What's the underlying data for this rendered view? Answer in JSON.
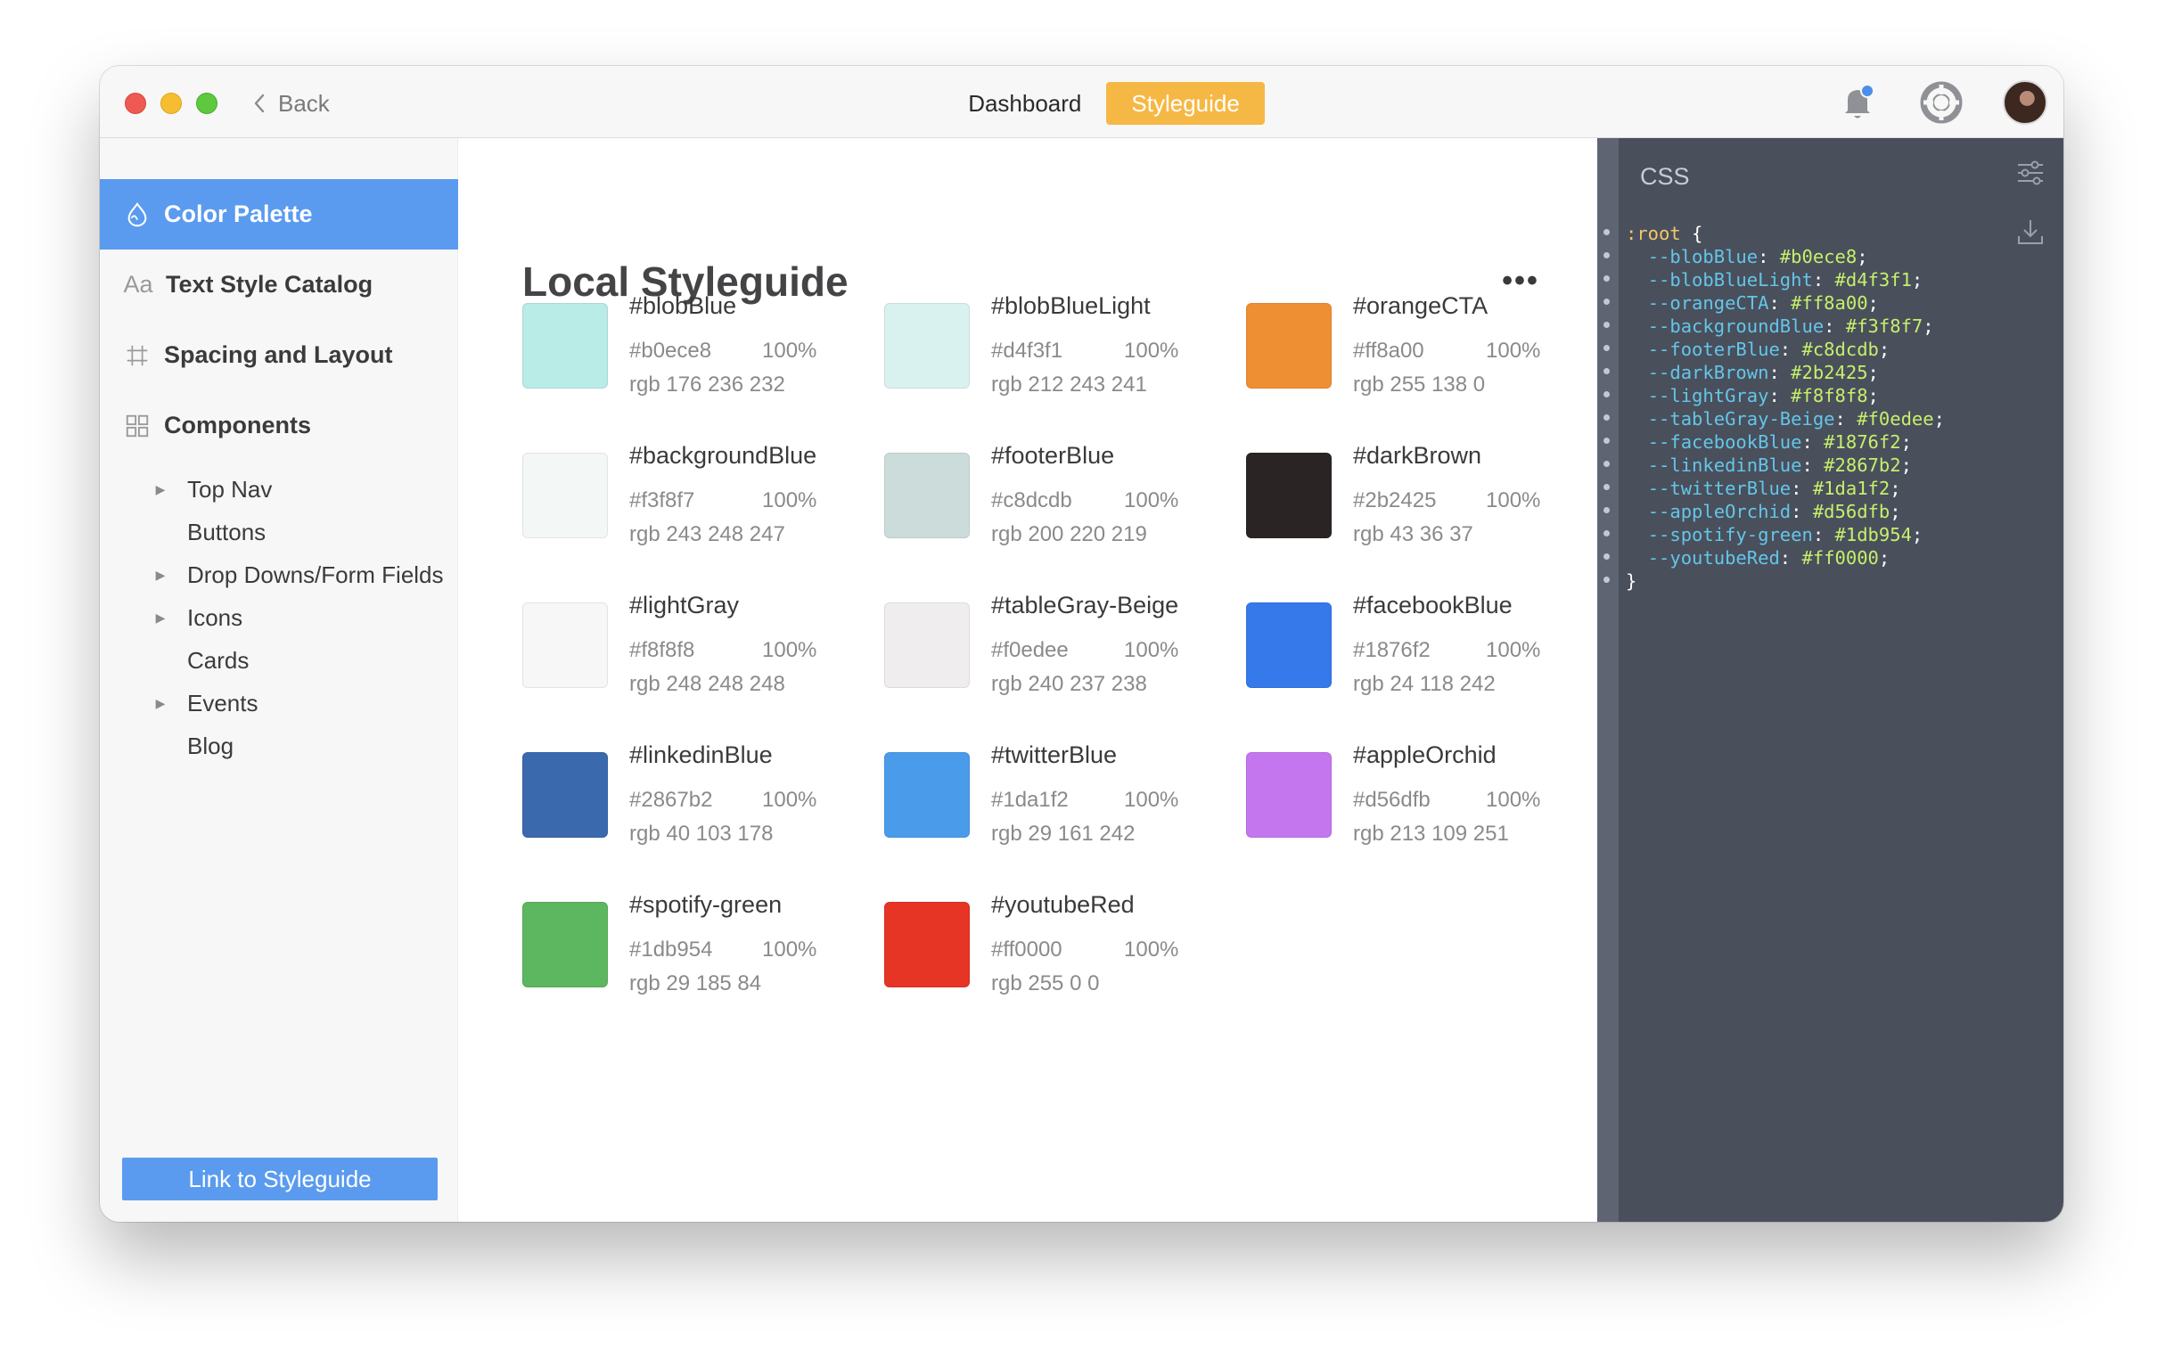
{
  "titlebar": {
    "back_label": "Back",
    "tabs": [
      {
        "label": "Dashboard",
        "active": false
      },
      {
        "label": "Styleguide",
        "active": true
      }
    ],
    "accent_color": "#f6b845"
  },
  "sidebar": {
    "items": [
      {
        "label": "Color Palette",
        "icon": "color-drop-icon",
        "active": true
      },
      {
        "label": "Text Style Catalog",
        "icon": "text-aa-icon",
        "active": false
      },
      {
        "label": "Spacing and Layout",
        "icon": "grid-hash-icon",
        "active": false
      },
      {
        "label": "Components",
        "icon": "components-grid-icon",
        "active": false
      }
    ],
    "components_children": [
      {
        "label": "Top Nav",
        "expandable": true
      },
      {
        "label": "Buttons",
        "expandable": false
      },
      {
        "label": "Drop Downs/Form Fields",
        "expandable": true
      },
      {
        "label": "Icons",
        "expandable": true
      },
      {
        "label": "Cards",
        "expandable": false
      },
      {
        "label": "Events",
        "expandable": true
      },
      {
        "label": "Blog",
        "expandable": false
      }
    ],
    "link_button": "Link to Styleguide",
    "active_color": "#5a9bef"
  },
  "main": {
    "title": "Local Styleguide",
    "more_label": "•••",
    "colors": [
      {
        "name": "#blobBlue",
        "hex": "#b0ece8",
        "opacity": "100%",
        "rgb": "rgb 176 236 232"
      },
      {
        "name": "#blobBlueLight",
        "hex": "#d4f3f1",
        "opacity": "100%",
        "rgb": "rgb 212 243 241"
      },
      {
        "name": "#orangeCTA",
        "hex": "#ff8a00",
        "opacity": "100%",
        "rgb": "rgb 255 138 0"
      },
      {
        "name": "#backgroundBlue",
        "hex": "#f3f8f7",
        "opacity": "100%",
        "rgb": "rgb 243 248 247"
      },
      {
        "name": "#footerBlue",
        "hex": "#c8dcdb",
        "opacity": "100%",
        "rgb": "rgb 200 220 219"
      },
      {
        "name": "#darkBrown",
        "hex": "#2b2425",
        "opacity": "100%",
        "rgb": "rgb 43 36 37"
      },
      {
        "name": "#lightGray",
        "hex": "#f8f8f8",
        "opacity": "100%",
        "rgb": "rgb 248 248 248"
      },
      {
        "name": "#tableGray-Beige",
        "hex": "#f0edee",
        "opacity": "100%",
        "rgb": "rgb 240 237 238"
      },
      {
        "name": "#facebookBlue",
        "hex": "#1876f2",
        "opacity": "100%",
        "rgb": "rgb 24 118 242"
      },
      {
        "name": "#linkedinBlue",
        "hex": "#2867b2",
        "opacity": "100%",
        "rgb": "rgb 40 103 178"
      },
      {
        "name": "#twitterBlue",
        "hex": "#1da1f2",
        "opacity": "100%",
        "rgb": "rgb 29 161 242"
      },
      {
        "name": "#appleOrchid",
        "hex": "#d56dfb",
        "opacity": "100%",
        "rgb": "rgb 213 109 251"
      },
      {
        "name": "#spotify-green",
        "hex": "#1db954",
        "opacity": "100%",
        "rgb": "rgb 29 185 84"
      },
      {
        "name": "#youtubeRed",
        "hex": "#ff0000",
        "opacity": "100%",
        "rgb": "rgb 255 0 0"
      }
    ],
    "swatch_display_colors": [
      "#b9ebe7",
      "#d9f2f0",
      "#ee8f33",
      "#f3f8f7",
      "#ccdcdb",
      "#2a2425",
      "#f7f7f7",
      "#efedee",
      "#3579ea",
      "#3a69ae",
      "#4a9ceb",
      "#c476ef",
      "#5db660",
      "#e63425"
    ]
  },
  "css_panel": {
    "title": "CSS",
    "selector": ":root",
    "open_brace": " {",
    "close_brace": "}",
    "variables": [
      {
        "prop": "--blobBlue",
        "value": "#b0ece8"
      },
      {
        "prop": "--blobBlueLight",
        "value": "#d4f3f1"
      },
      {
        "prop": "--orangeCTA",
        "value": "#ff8a00"
      },
      {
        "prop": "--backgroundBlue",
        "value": "#f3f8f7"
      },
      {
        "prop": "--footerBlue",
        "value": "#c8dcdb"
      },
      {
        "prop": "--darkBrown",
        "value": "#2b2425"
      },
      {
        "prop": "--lightGray",
        "value": "#f8f8f8"
      },
      {
        "prop": "--tableGray-Beige",
        "value": "#f0edee"
      },
      {
        "prop": "--facebookBlue",
        "value": "#1876f2"
      },
      {
        "prop": "--linkedinBlue",
        "value": "#2867b2"
      },
      {
        "prop": "--twitterBlue",
        "value": "#1da1f2"
      },
      {
        "prop": "--appleOrchid",
        "value": "#d56dfb"
      },
      {
        "prop": "--spotify-green",
        "value": "#1db954"
      },
      {
        "prop": "--youtubeRed",
        "value": "#ff0000"
      }
    ],
    "background_color": "#4a4f5c"
  }
}
